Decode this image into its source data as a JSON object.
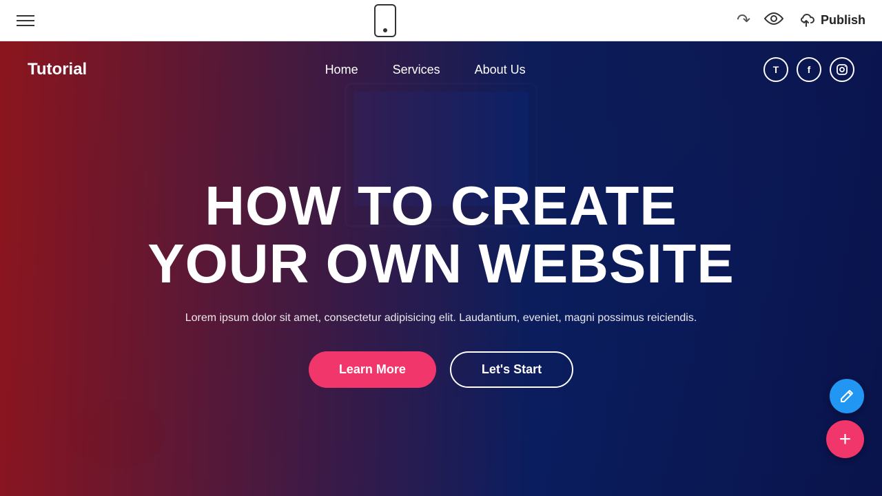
{
  "toolbar": {
    "hamburger_label": "menu",
    "phone_icon": "phone-icon",
    "undo_icon": "↩",
    "eye_symbol": "👁",
    "publish_label": "Publish",
    "cloud_icon": "☁"
  },
  "site": {
    "logo": "Tutorial",
    "nav": {
      "home": "Home",
      "services": "Services",
      "about": "About Us"
    },
    "social": {
      "twitter": "T",
      "facebook": "f",
      "instagram": "in"
    }
  },
  "hero": {
    "title_line1": "HOW TO CREATE",
    "title_line2": "YOUR OWN WEBSITE",
    "subtitle": "Lorem ipsum dolor sit amet, consectetur adipisicing elit. Laudantium, eveniet, magni possimus reiciendis.",
    "btn_learn_more": "Learn More",
    "btn_lets_start": "Let's Start"
  },
  "fab": {
    "pencil_icon": "✏",
    "plus_icon": "+"
  }
}
